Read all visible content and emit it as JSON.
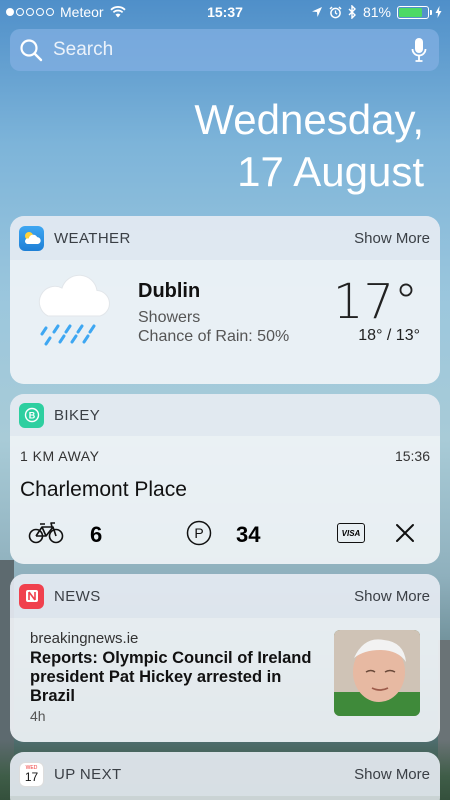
{
  "status_bar": {
    "carrier": "Meteor",
    "time": "15:37",
    "battery": "81%",
    "battery_level": 0.81,
    "signal_bars": 1
  },
  "search": {
    "placeholder": "Search"
  },
  "date": {
    "line1": "Wednesday,",
    "line2": "17 August"
  },
  "weather": {
    "title": "WEATHER",
    "show_more": "Show More",
    "city": "Dublin",
    "condition": "Showers",
    "rain": "Chance of Rain: 50%",
    "temperature": "17°",
    "range": "18° / 13°",
    "icon": "cloud-rain-icon"
  },
  "bikey": {
    "title": "BIKEY",
    "distance": "1 KM AWAY",
    "time": "15:36",
    "station": "Charlemont Place",
    "bikes": "6",
    "docks": "34",
    "card_label": "VISA"
  },
  "news": {
    "title": "NEWS",
    "show_more": "Show More",
    "source": "breakingnews.ie",
    "headline": "Reports: Olympic Council of Ireland president Pat Hickey arrested in Brazil",
    "age": "4h"
  },
  "up_next": {
    "title": "UP NEXT",
    "show_more": "Show More",
    "icon_month": "WED",
    "icon_day": "17"
  },
  "colors": {
    "battery_green": "#4cd964",
    "weather_icon": "#3ea7f2",
    "bikey_icon": "#2ecfa0",
    "news_icon": "#f0414e"
  }
}
